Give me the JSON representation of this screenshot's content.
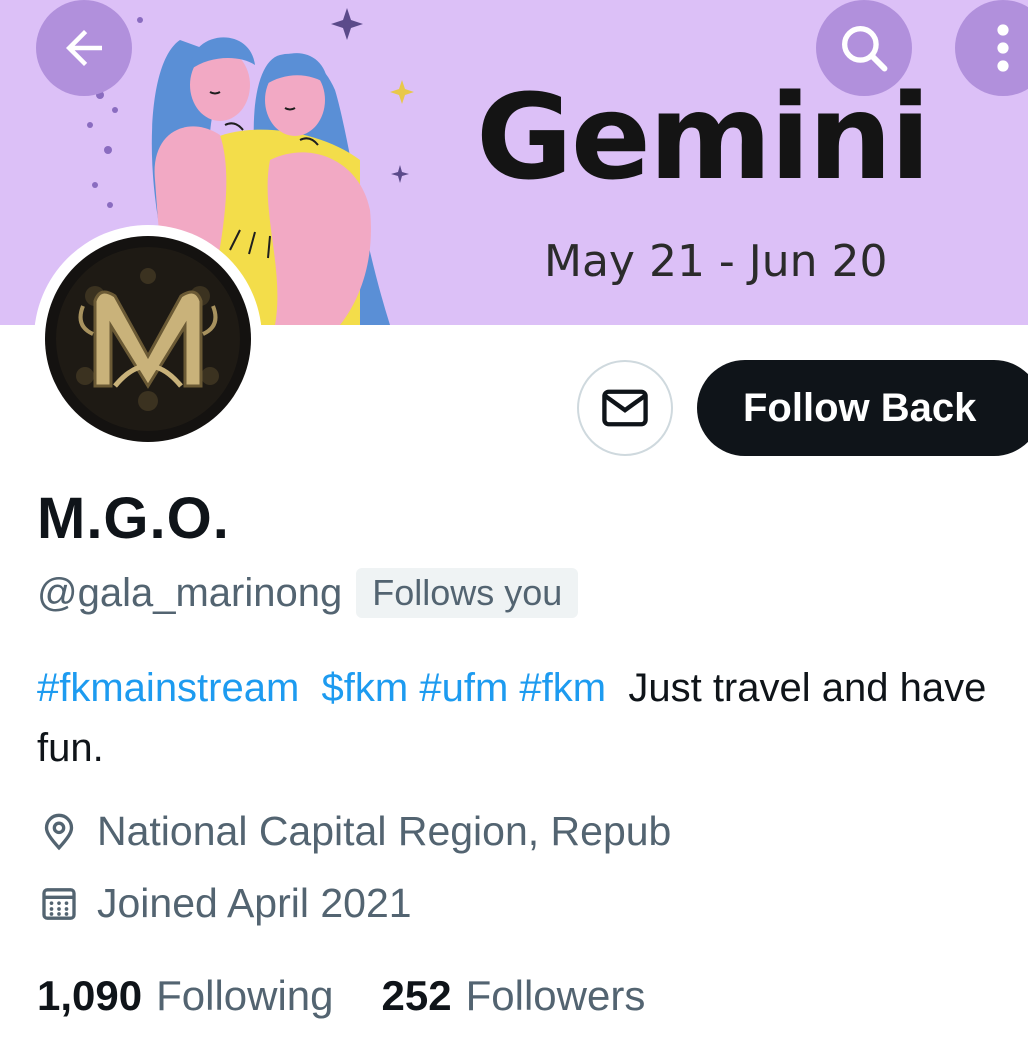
{
  "banner": {
    "title": "Gemini",
    "dates": "May 21 - Jun 20",
    "background": "#dcc0f7"
  },
  "header_icons": {
    "back": "arrow-left-icon",
    "search": "search-icon",
    "more": "more-vertical-icon"
  },
  "profile": {
    "display_name": "M.G.O.",
    "handle": "@gala_marinong",
    "follows_you": "Follows you",
    "follow_button": "Follow Back",
    "message_icon": "envelope-icon"
  },
  "bio": {
    "tags": [
      "#fkmainstream",
      "$fkm",
      "#ufm",
      "#fkm"
    ],
    "text": "Just travel and have fun."
  },
  "meta": {
    "location": "National Capital Region, Repub",
    "joined": "Joined April 2021"
  },
  "stats": {
    "following_count": "1,090",
    "following_label": "Following",
    "followers_count": "252",
    "followers_label": "Followers"
  },
  "colors": {
    "link": "#1d9bf0",
    "secondary_text": "#536471",
    "primary_text": "#0f1419"
  }
}
